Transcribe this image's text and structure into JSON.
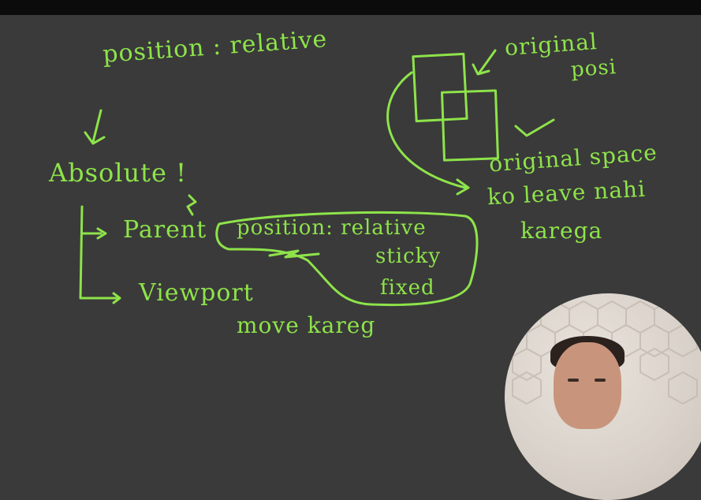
{
  "colors": {
    "board": "#3a3a3a",
    "ink": "#8ee34a",
    "topbar": "#0b0b0b"
  },
  "notes": {
    "position_relative": "position : relative",
    "original_posi_1": "original",
    "original_posi_2": "posi",
    "absolute": "Absolute !",
    "parent": "Parent",
    "viewport": "Viewport",
    "move_kareg": "move kareg",
    "pos_relative": "position: relative",
    "sticky": "sticky",
    "fixed": "fixed",
    "orig_space_1": "original space",
    "orig_space_2": "ko leave nahi",
    "orig_space_3": "karega"
  },
  "video": {
    "label": "presenter webcam"
  }
}
